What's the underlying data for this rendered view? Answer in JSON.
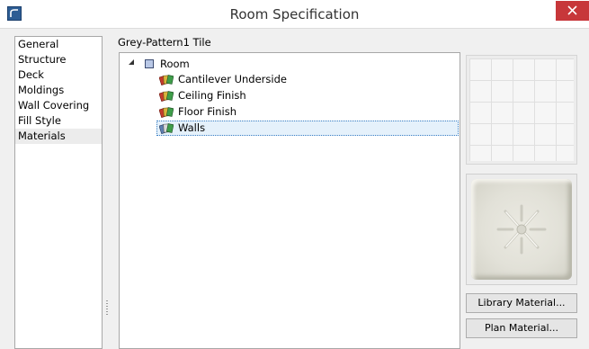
{
  "window": {
    "title": "Room Specification",
    "close_icon": "close-icon",
    "app_icon": "chief-architect-icon"
  },
  "nav": {
    "items": [
      {
        "label": "General",
        "selected": false
      },
      {
        "label": "Structure",
        "selected": false
      },
      {
        "label": "Deck",
        "selected": false
      },
      {
        "label": "Moldings",
        "selected": false
      },
      {
        "label": "Wall Covering",
        "selected": false
      },
      {
        "label": "Fill Style",
        "selected": false
      },
      {
        "label": "Materials",
        "selected": true
      }
    ]
  },
  "materials": {
    "current_material": "Grey-Pattern1 Tile",
    "tree": {
      "root": {
        "label": "Room",
        "expanded": true,
        "icon": "room-icon"
      },
      "children": [
        {
          "label": "Cantilever Underside",
          "icon": "material-icon"
        },
        {
          "label": "Ceiling Finish",
          "icon": "material-icon"
        },
        {
          "label": "Floor Finish",
          "icon": "material-icon"
        },
        {
          "label": "Walls",
          "icon": "material-icon",
          "selected": true
        }
      ]
    },
    "buttons": {
      "library_material": "Library Material...",
      "plan_material": "Plan Material..."
    }
  },
  "colors": {
    "close_button": "#c7373a",
    "selection_fill": "#e5f1fb",
    "selection_border": "#3a7fc4"
  }
}
